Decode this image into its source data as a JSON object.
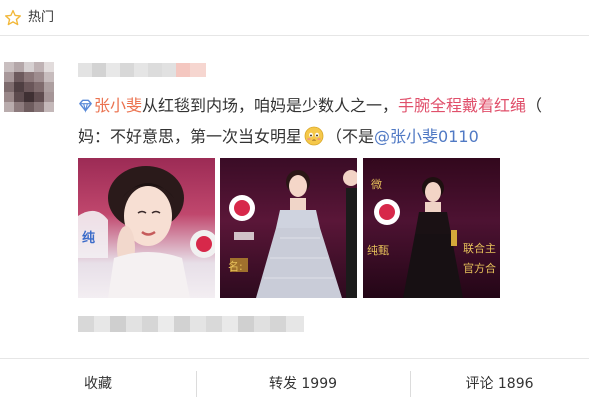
{
  "header": {
    "title": "热门",
    "icon": "star-outline-icon"
  },
  "post": {
    "tag_icon": "diamond-topic-icon",
    "line1": {
      "link_user": "张小斐",
      "text_a": "从红毯到内场，咱妈是少数人之一，",
      "highlight": "手腕全程戴着红绳",
      "tail": "（"
    },
    "line2": {
      "text_a": "妈：不好意思，第一次当女明星",
      "emoji": "shy-face-emoji",
      "text_b": "（不是",
      "mention": "@张小斐0110"
    },
    "photos": [
      {
        "name": "photo-1"
      },
      {
        "name": "photo-2"
      },
      {
        "name": "photo-3"
      }
    ]
  },
  "actions": {
    "favorite": "收藏",
    "forward": "转发 1999",
    "comment": "评论 1896"
  },
  "colors": {
    "link": "#eb7350",
    "mention": "#5079c4",
    "highlight": "#e0506b",
    "text": "#333333",
    "border": "#e6e6e6"
  }
}
